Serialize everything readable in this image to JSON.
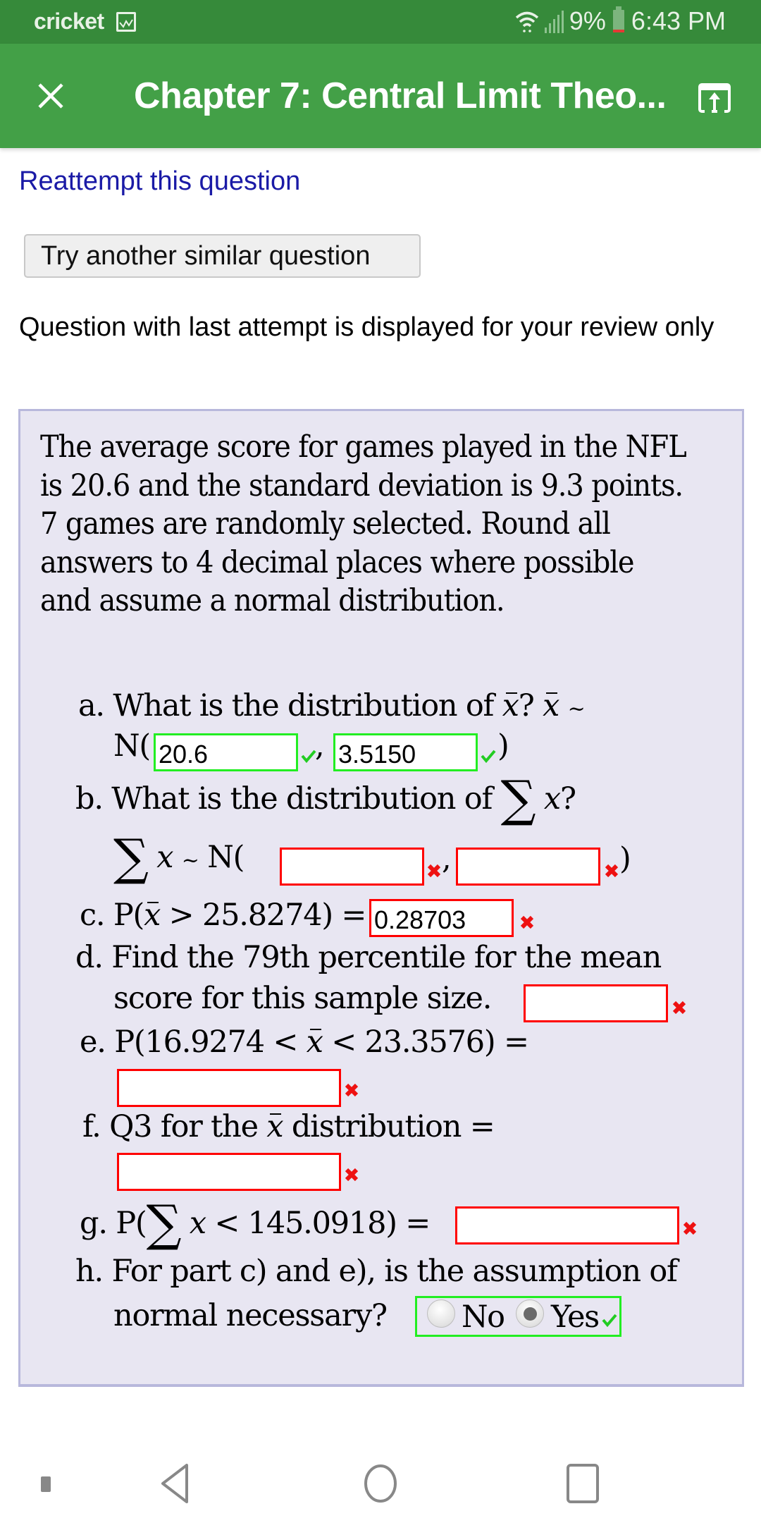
{
  "status_bar": {
    "carrier": "cricket",
    "battery_percent": "9%",
    "time": "6:43 PM",
    "icons": [
      "image-notification-icon",
      "wifi-icon",
      "cell-signal-icon",
      "battery-icon"
    ]
  },
  "app_bar": {
    "title": "Chapter 7: Central Limit Theo...",
    "close_icon": "close-icon",
    "share_icon": "open-external-icon"
  },
  "actions": {
    "reattempt_link": "Reattempt this question",
    "try_another_button": "Try another similar question"
  },
  "review_note": "Question with last attempt is displayed for your review only",
  "colors": {
    "status_bar": "#368a3a",
    "app_bar": "#43a047",
    "link": "#1a1aa6",
    "question_bg": "#e8e6f2",
    "question_border": "#b8b8dc",
    "correct": "#22ee22",
    "incorrect": "#ff0000"
  },
  "question": {
    "intro": "The average score for games played in the NFL is 20.6 and the standard deviation is 9.3 points. 7 games are randomly selected. Round all answers to 4 decimal places where possible and assume a normal distribution.",
    "parts": {
      "a": {
        "label": "a.",
        "text": "What is the distribution of",
        "q_mark": "?",
        "tilde": "~",
        "n_open": "N(",
        "comma": ",",
        "close": ")",
        "answers": [
          {
            "value": "20.6",
            "status": "correct"
          },
          {
            "value": "3.5150",
            "status": "correct"
          }
        ]
      },
      "b": {
        "label": "b.",
        "text": "What is the distribution of",
        "q_mark": "?",
        "tilde": "~",
        "n_open": "N(",
        "comma": ",",
        "close": ")",
        "answers": [
          {
            "value": "",
            "status": "incorrect"
          },
          {
            "value": "",
            "status": "incorrect"
          }
        ]
      },
      "c": {
        "label": "c.",
        "prefix": "P(",
        "suffix": " > 25.8274) =",
        "answer": {
          "value": "0.28703",
          "status": "incorrect"
        }
      },
      "d": {
        "label": "d.",
        "line1": "Find the 79th percentile for the mean",
        "line2": "score for this sample size.",
        "answer": {
          "value": "",
          "status": "incorrect"
        }
      },
      "e": {
        "label": "e.",
        "prefix": "P(16.9274 <",
        "suffix": "< 23.3576) =",
        "answer": {
          "value": "",
          "status": "incorrect"
        }
      },
      "f": {
        "label": "f.",
        "prefix": "Q3 for the",
        "suffix": "distribution =",
        "answer": {
          "value": "",
          "status": "incorrect"
        }
      },
      "g": {
        "label": "g.",
        "prefix": "P(",
        "suffix": "< 145.0918) =",
        "answer": {
          "value": "",
          "status": "incorrect"
        }
      },
      "h": {
        "label": "h.",
        "line1": "For part c) and e), is the assumption of",
        "line2": "normal necessary?",
        "options": [
          {
            "label": "No",
            "selected": false
          },
          {
            "label": "Yes",
            "selected": true
          }
        ],
        "status": "correct"
      }
    }
  },
  "nav_bar": {
    "icons": [
      "nav-indicator-icon",
      "back-icon",
      "home-icon",
      "recents-icon"
    ]
  }
}
